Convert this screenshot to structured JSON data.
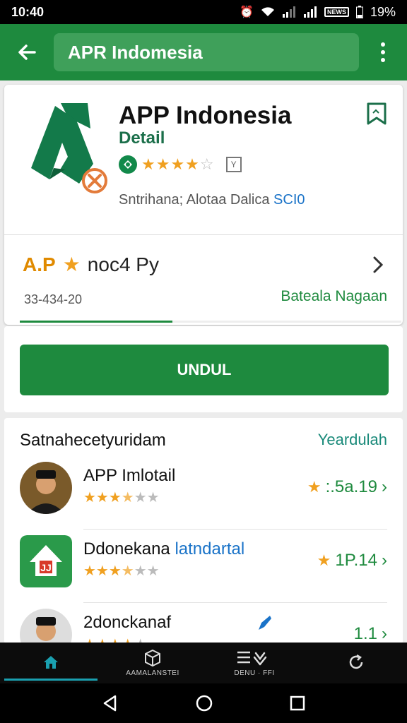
{
  "status_bar": {
    "time": "10:40",
    "battery_text": "19%",
    "battery_box_label": "NEWS"
  },
  "app_bar": {
    "search_text": "APR Indomesia",
    "back_icon": "arrow-left-icon",
    "menu_icon": "more-vert-icon"
  },
  "app": {
    "title": "APP Indonesia",
    "subtitle": "Detail",
    "rating": 3.5,
    "meta_text": "Sntrihana; Alotaa Dalica ",
    "meta_accent": "SCI0",
    "bookmark_icon": "bookmark-icon"
  },
  "info": {
    "prefix": "A.P",
    "title": "noc4 Py",
    "date": "33-434-20",
    "link": "Bateala Nagaan",
    "progress": 0.4
  },
  "download": {
    "label": "UNDUL"
  },
  "similar": {
    "title": "Satnahecetyuridam",
    "more": "Yeardulah",
    "items": [
      {
        "name": "APP Imlotail",
        "accent": "",
        "stars": 3.5,
        "score": ":.5a.19",
        "icon": "person-avatar"
      },
      {
        "name": "Ddonekana ",
        "accent": "latndartal",
        "stars": 3.5,
        "score": "1P.14",
        "icon": "green-app-icon"
      },
      {
        "name": "2donckanaf",
        "accent": "",
        "stars": 4,
        "score": "1.1",
        "icon": "person-avatar"
      }
    ]
  },
  "bottom_nav": {
    "items": [
      {
        "label": "",
        "icon": "home-icon",
        "active": true
      },
      {
        "label": "AAMALANSTEI",
        "icon": "box-icon",
        "active": false
      },
      {
        "label": "DENU · FFI",
        "icon": "menu-heart-icon",
        "active": false
      },
      {
        "label": "",
        "icon": "refresh-icon",
        "active": false
      }
    ]
  },
  "colors": {
    "primary": "#1e8a3e",
    "star": "#f0a020",
    "accent_blue": "#1a73c8"
  }
}
